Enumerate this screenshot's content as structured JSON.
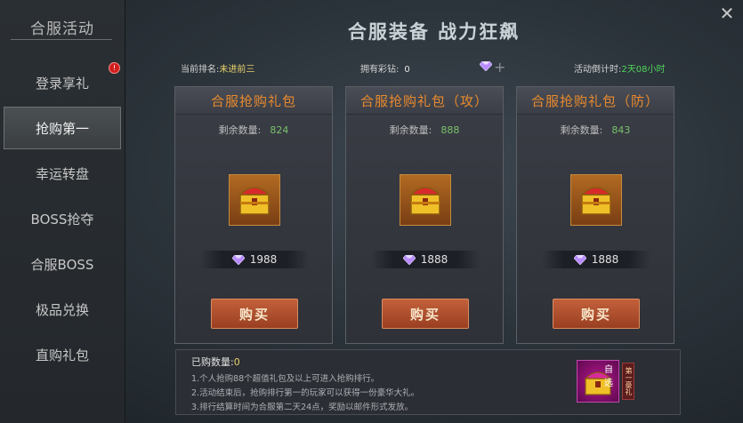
{
  "sidebar": {
    "title": "合服活动",
    "items": [
      {
        "label": "登录享礼",
        "active": false,
        "badge": "!"
      },
      {
        "label": "抢购第一",
        "active": true
      },
      {
        "label": "幸运转盘",
        "active": false
      },
      {
        "label": "BOSS抢夺",
        "active": false
      },
      {
        "label": "合服BOSS",
        "active": false
      },
      {
        "label": "极品兑换",
        "active": false
      },
      {
        "label": "直购礼包",
        "active": false
      }
    ]
  },
  "header": {
    "title": "合服装备 战力狂飙",
    "close": "✕"
  },
  "info": {
    "rank_label": "当前排名:",
    "rank_value": "未进前三",
    "diamond_label": "拥有彩钻:",
    "diamond_value": "0",
    "plus": "+",
    "countdown_label": "活动倒计时:",
    "countdown_value": "2天08小时"
  },
  "cards": [
    {
      "title": "合服抢购礼包",
      "remain_label": "剩余数量:",
      "remain": "824",
      "price": "1988",
      "buy": "购买"
    },
    {
      "title": "合服抢购礼包（攻）",
      "remain_label": "剩余数量:",
      "remain": "888",
      "price": "1888",
      "buy": "购买"
    },
    {
      "title": "合服抢购礼包（防）",
      "remain_label": "剩余数量:",
      "remain": "843",
      "price": "1888",
      "buy": "购买"
    }
  ],
  "notes": {
    "bought_label": "已购数量:",
    "bought_value": "0",
    "lines": [
      "1.个人抢购88个超值礼包及以上可进入抢购排行。",
      "2.活动结束后，抢购排行第一的玩家可以获得一份豪华大礼。",
      "3.排行结算时间为合服第二天24点，奖励以邮件形式发放。"
    ],
    "reward_tag": "自选",
    "reward_side": "第一豪礼"
  },
  "colors": {
    "accent_orange": "#e98a2e",
    "green": "#4fd45a",
    "gold": "#e9d36a",
    "buy_button": "#b04e2c"
  }
}
